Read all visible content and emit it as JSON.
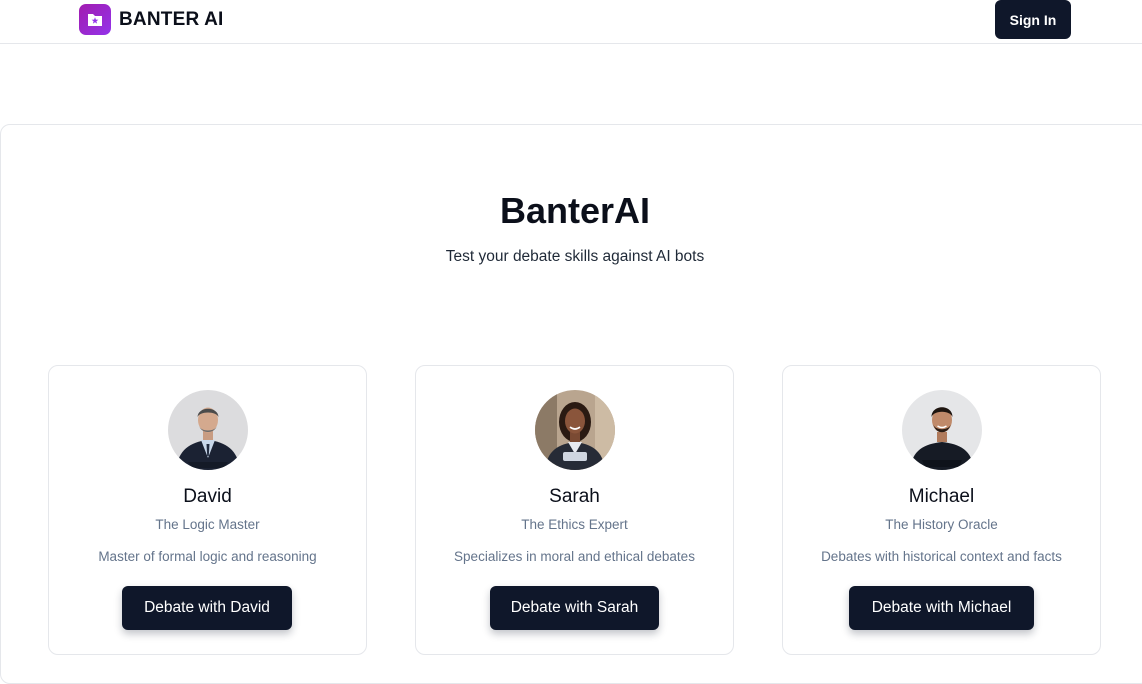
{
  "nav": {
    "brand_name": "BANTER AI",
    "signin_label": "Sign In"
  },
  "hero": {
    "title": "BanterAI",
    "subtitle": "Test your debate skills against AI bots"
  },
  "bots": [
    {
      "name": "David",
      "title": "The Logic Master",
      "description": "Master of formal logic and reasoning",
      "button_label": "Debate with David"
    },
    {
      "name": "Sarah",
      "title": "The Ethics Expert",
      "description": "Specializes in moral and ethical debates",
      "button_label": "Debate with Sarah"
    },
    {
      "name": "Michael",
      "title": "The History Oracle",
      "description": "Debates with historical context and facts",
      "button_label": "Debate with Michael"
    }
  ],
  "colors": {
    "brand_purple": "#9333ea",
    "button_dark": "#0f172a",
    "muted_text": "#64748b"
  }
}
